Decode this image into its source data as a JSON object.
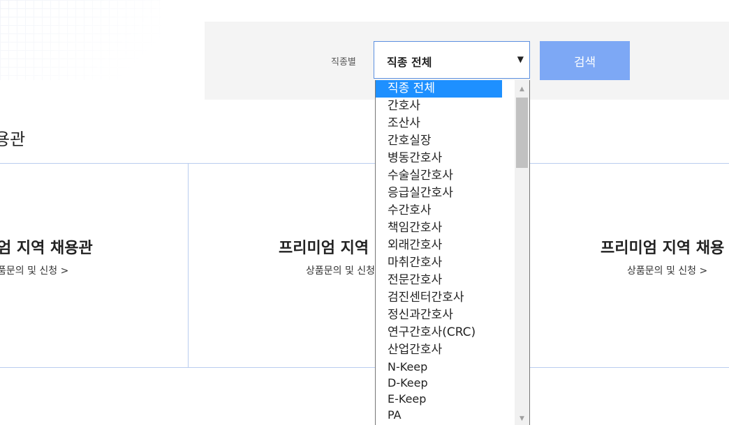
{
  "filter": {
    "label": "직종별",
    "selected": "직종 전체",
    "search_label": "검색"
  },
  "section": {
    "title": "용관"
  },
  "cards": [
    {
      "title": "엄 지역 채용관",
      "link": "품문의 및 신청 >"
    },
    {
      "title": "프리미엄 지역",
      "link": "상품문의 및 신청"
    },
    {
      "title": "프리미엄 지역 채용",
      "link": "상품문의 및 신청 >"
    }
  ],
  "dropdown": {
    "options": [
      "직종 전체",
      "간호사",
      "조산사",
      "간호실장",
      "병동간호사",
      "수술실간호사",
      "응급실간호사",
      "수간호사",
      "책임간호사",
      "외래간호사",
      "마취간호사",
      "전문간호사",
      "검진센터간호사",
      "정신과간호사",
      "연구간호사(CRC)",
      "산업간호사",
      "N-Keep",
      "D-Keep",
      "E-Keep",
      "PA"
    ],
    "selected_index": 0
  },
  "icons": {
    "select_arrow": "triangle-down-icon",
    "scroll_up": "scroll-up-arrow-icon",
    "scroll_down": "scroll-down-arrow-icon"
  },
  "colors": {
    "accent": "#7da8f5",
    "select_border": "#5b8fe0",
    "selected_option": "#1e90ff",
    "divider": "#b9cdef",
    "filter_bg": "#f4f4f4"
  }
}
